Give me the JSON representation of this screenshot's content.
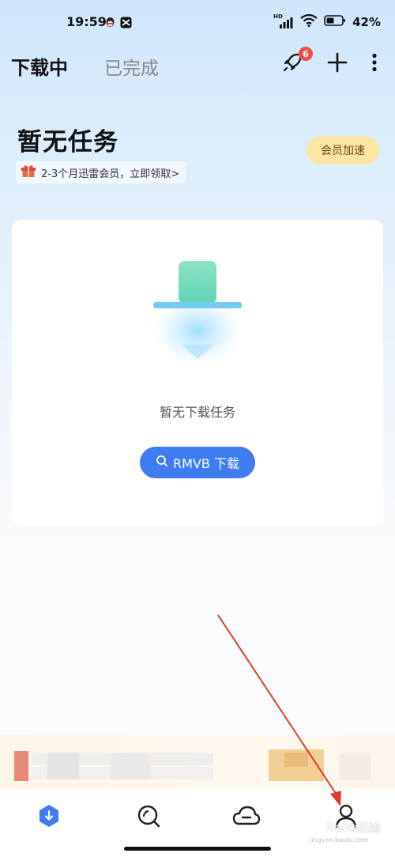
{
  "status_bar": {
    "time": "19:59",
    "network_label": "HD",
    "battery_text": "42%",
    "icons": [
      "qq-icon",
      "capcut-icon",
      "signal-icon",
      "wifi-icon",
      "battery-icon"
    ]
  },
  "header": {
    "tabs": [
      {
        "label": "下载中",
        "active": true
      },
      {
        "label": "已完成",
        "active": false
      }
    ],
    "actions": {
      "rocket_badge": "6",
      "icons": [
        "rocket-icon",
        "plus-icon",
        "more-icon"
      ]
    }
  },
  "empty_state": {
    "title": "暂无任务",
    "promo_text": "2-3个月迅雷会员，立即领取>",
    "vip_button_label": "会员加速"
  },
  "card": {
    "empty_text": "暂无下载任务",
    "search_button_label": "RMVB 下载"
  },
  "bottom_nav": {
    "items": [
      "download-tab",
      "discover-tab",
      "cloud-tab",
      "profile-tab"
    ]
  },
  "watermark": {
    "text": "Bai",
    "text_cn": "经验",
    "sub": "jingyan.baidu.com"
  },
  "colors": {
    "accent_blue": "#3e7cf0",
    "vip_gold": "#fbe6a3",
    "badge_red": "#ee4b4b",
    "arrow_red": "#e23b2e"
  }
}
